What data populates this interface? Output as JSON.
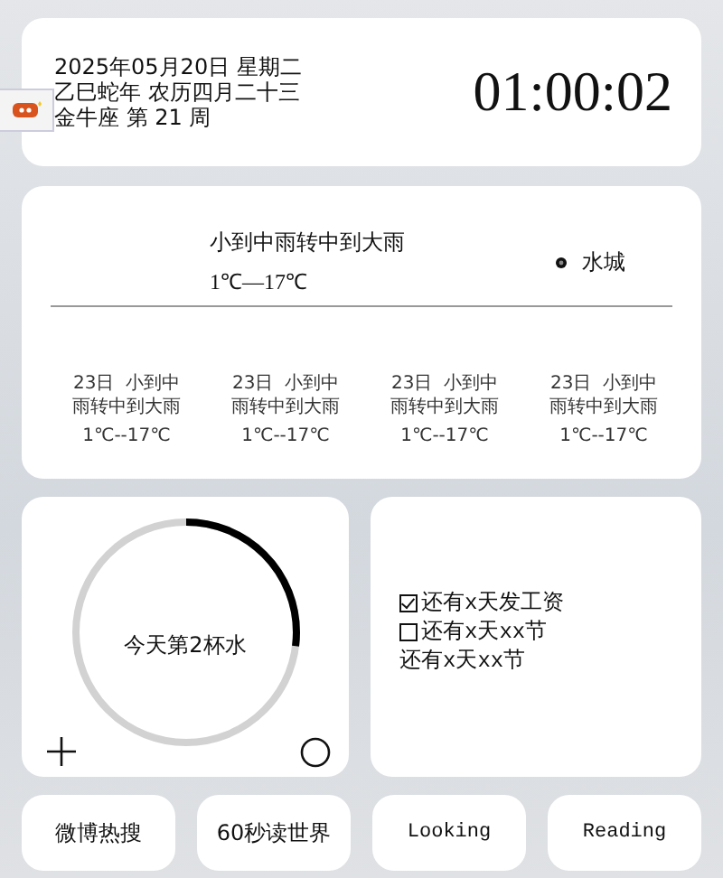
{
  "date_card": {
    "lines": [
      "2025年05月20日 星期二",
      "乙巳蛇年 农历四月二十三",
      "金牛座 第 21 周"
    ],
    "clock": "01:00:02"
  },
  "weather": {
    "condition": "小到中雨转中到大雨",
    "range": "1℃—17℃",
    "location": "水城",
    "forecast": [
      {
        "day": "23日",
        "condition": "小到中雨转中到大雨",
        "range": "1℃--17℃"
      },
      {
        "day": "23日",
        "condition": "小到中雨转中到大雨",
        "range": "1℃--17℃"
      },
      {
        "day": "23日",
        "condition": "小到中雨转中到大雨",
        "range": "1℃--17℃"
      },
      {
        "day": "23日",
        "condition": "小到中雨转中到大雨",
        "range": "1℃--17℃"
      }
    ]
  },
  "water": {
    "label": "今天第2杯水",
    "level": 0.27
  },
  "reminders": [
    {
      "kind": "checkbox",
      "checked": true,
      "text": "还有x天发工资"
    },
    {
      "kind": "checkbox",
      "checked": false,
      "text": "还有x天xx节"
    },
    {
      "kind": "plain",
      "text": "还有x天xx节"
    }
  ],
  "shortcuts": [
    {
      "label": "微博热搜",
      "kind": "sans"
    },
    {
      "label": "60秒读世界",
      "kind": "sans"
    },
    {
      "label": "Looking",
      "kind": "mono"
    },
    {
      "label": "Reading",
      "kind": "mono"
    }
  ]
}
